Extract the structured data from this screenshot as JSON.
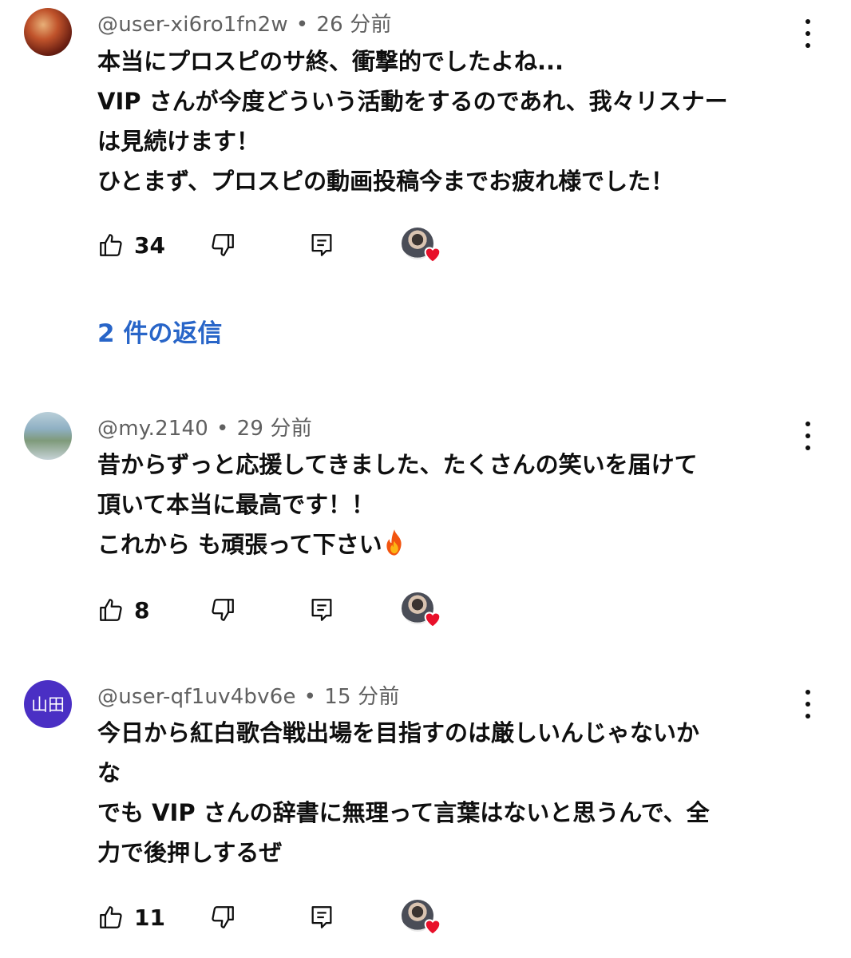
{
  "comments": [
    {
      "handle": "@user-xi6ro1fn2w",
      "time": "26 分前",
      "lines": [
        "本当にプロスピのサ終、衝撃的でしたよね...",
        "VIP さんが今度どういう活動をするのであれ、我々リスナー",
        "は見続けます！",
        "ひとまず、プロスピの動画投稿今までお疲れ様でした！"
      ],
      "likes": "34",
      "avatar_icon": "user-avatar-photo",
      "hearted_by_creator": true
    },
    {
      "handle": "@my.2140",
      "time": "29 分前",
      "lines": [
        "昔からずっと応援してきました、たくさんの笑いを届けて",
        "頂いて本当に最高です！！",
        "これから も頑張って下さい"
      ],
      "emoji": "fire-emoji",
      "likes": "8",
      "avatar_icon": "user-avatar-photo",
      "hearted_by_creator": true
    },
    {
      "handle": "@user-qf1uv4bv6e",
      "time": "15 分前",
      "lines": [
        "今日から紅白歌合戦出場を目指すのは厳しいんじゃないか",
        "な",
        "でも VIP さんの辞書に無理って言葉はないと思うんで、全",
        "力で後押しするぜ"
      ],
      "likes": "11",
      "avatar_text": "山田",
      "hearted_by_creator": true
    }
  ],
  "replies_link": "2 件の返信",
  "colors": {
    "link": "#2865c8",
    "heart": "#e8102a",
    "meta": "#606060",
    "avatar3": "#4a2fc4"
  },
  "icons": [
    "thumb-up-icon",
    "thumb-down-icon",
    "reply-icon",
    "more-vert-icon",
    "creator-heart-icon"
  ]
}
